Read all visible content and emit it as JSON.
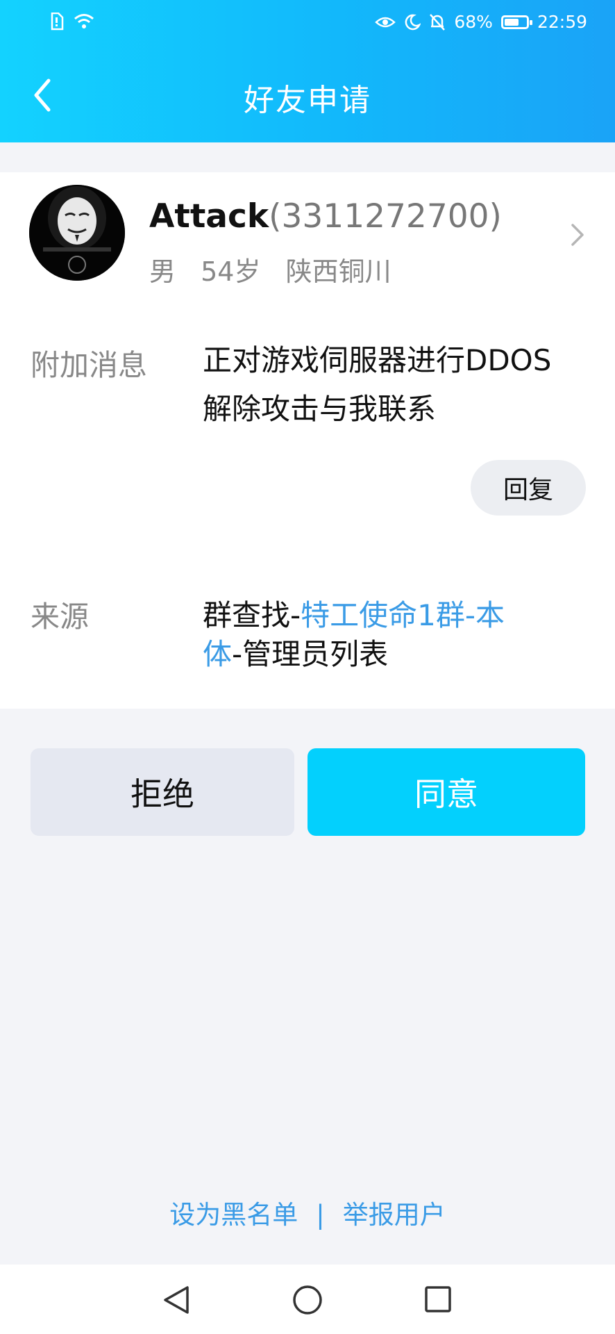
{
  "status": {
    "battery_pct": "68%",
    "battery_level": 0.68,
    "time": "22:59",
    "icons_left": [
      "sim-icon",
      "wifi-icon"
    ],
    "icons_right": [
      "eye-comfort-icon",
      "moon-icon",
      "mute-bell-icon"
    ]
  },
  "header": {
    "title": "好友申请"
  },
  "profile": {
    "name": "Attack",
    "qq": "(3311272700)",
    "gender": "男",
    "age": "54岁",
    "location": "陕西铜川"
  },
  "message": {
    "label": "附加消息",
    "line1": "正对游戏伺服器进行DDOS",
    "line2": "解除攻击与我联系",
    "reply_label": "回复"
  },
  "source": {
    "label": "来源",
    "prefix": "群查找-",
    "link1": "特工使命1群-本",
    "link2": "体",
    "suffix": "-管理员列表"
  },
  "actions": {
    "reject": "拒绝",
    "accept": "同意"
  },
  "footer": {
    "blacklist": "设为黑名单",
    "separator": "|",
    "report": "举报用户"
  },
  "colors": {
    "header": "#12c0fd",
    "accept": "#03d0fd",
    "link": "#3a9be6",
    "background": "#f3f4f8"
  }
}
